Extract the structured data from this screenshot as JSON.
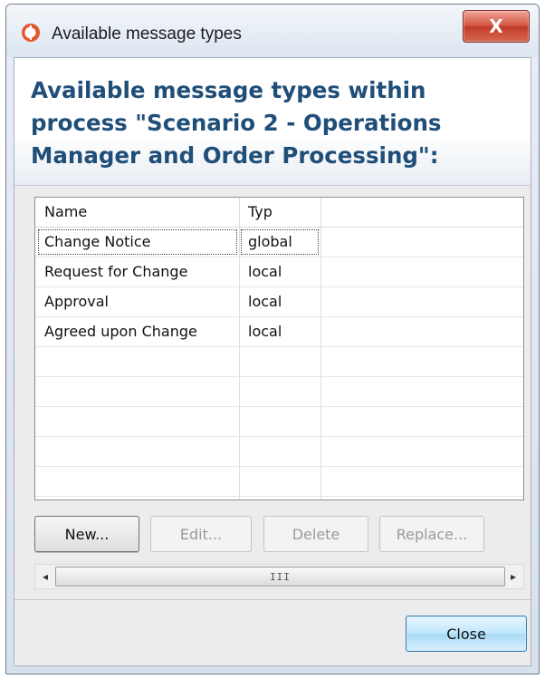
{
  "window": {
    "title": "Available message types",
    "close_glyph": "X",
    "app_icon": "app-logo-icon"
  },
  "header": {
    "heading": "Available message types within process \"Scenario 2 - Operations Manager and Order Processing\":"
  },
  "table": {
    "columns": [
      "Name",
      "Typ"
    ],
    "rows": [
      {
        "name": "Change Notice",
        "type": "global"
      },
      {
        "name": "Request for Change",
        "type": "local"
      },
      {
        "name": "Approval",
        "type": "local"
      },
      {
        "name": "Agreed upon Change",
        "type": "local"
      }
    ]
  },
  "buttons": {
    "new": "New...",
    "edit": "Edit...",
    "delete": "Delete",
    "replace": "Replace...",
    "close": "Close"
  },
  "scrollbar": {
    "left_arrow": "◂",
    "right_arrow": "▸",
    "thumb_grip": "III"
  },
  "colors": {
    "heading": "#1f4e79",
    "close_x": "#d2533f",
    "default_button": "#bee6fd"
  }
}
